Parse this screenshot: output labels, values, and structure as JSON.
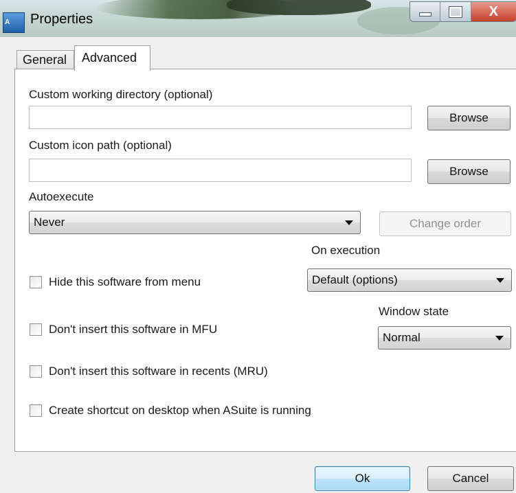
{
  "window": {
    "title": "Properties",
    "icon": "asuite-app-icon",
    "caption_close": "X"
  },
  "tabs": [
    {
      "label": "General",
      "selected": false
    },
    {
      "label": "Advanced",
      "selected": true
    }
  ],
  "advanced": {
    "working_dir": {
      "label": "Custom working directory (optional)",
      "value": "",
      "browse_label": "Browse"
    },
    "icon_path": {
      "label": "Custom icon path (optional)",
      "value": "",
      "browse_label": "Browse"
    },
    "autoexecute": {
      "label": "Autoexecute",
      "value": "Never",
      "change_order_label": "Change order",
      "change_order_enabled": false
    },
    "on_execution": {
      "label": "On execution",
      "value": "Default (options)"
    },
    "window_state": {
      "label": "Window state",
      "value": "Normal"
    },
    "checkboxes": [
      {
        "label": "Hide this software from menu",
        "checked": false
      },
      {
        "label": "Don't insert this software in MFU",
        "checked": false
      },
      {
        "label": "Don't insert this software in recents (MRU)",
        "checked": false
      },
      {
        "label": "Create shortcut on desktop when ASuite is running",
        "checked": false
      }
    ]
  },
  "footer": {
    "ok_label": "Ok",
    "cancel_label": "Cancel"
  }
}
